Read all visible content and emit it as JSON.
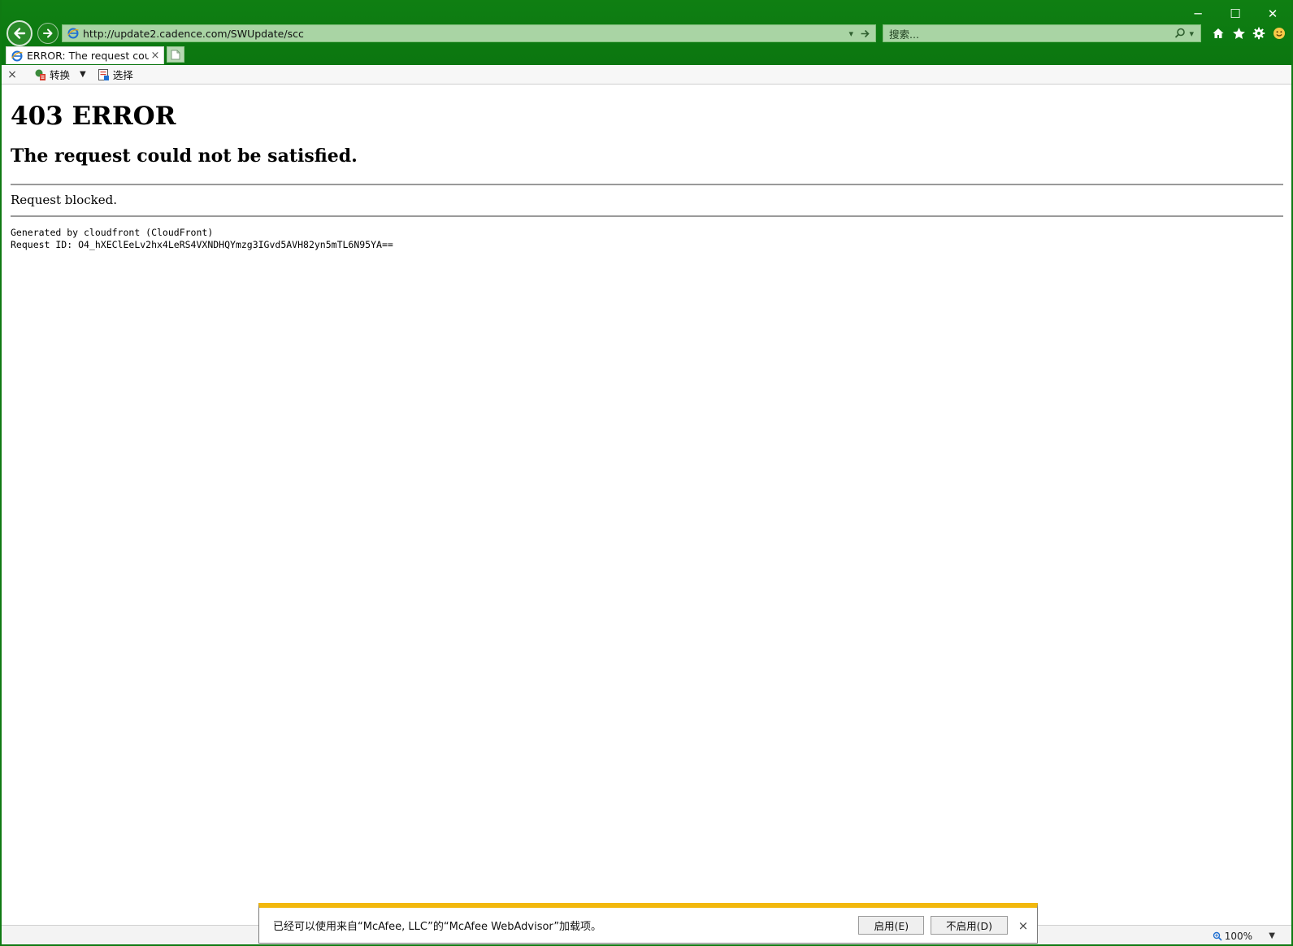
{
  "browser": {
    "address": {
      "url": "http://update2.cadence.com/SWUpdate/scc"
    },
    "search": {
      "placeholder": "搜索..."
    },
    "window_controls": {
      "minimize": "─",
      "maximize": "☐",
      "close": "✕"
    },
    "tab": {
      "title": "ERROR: The request coul...",
      "close": "×"
    },
    "toolbar": {
      "close": "×",
      "convert_label": "转换",
      "select_label": "选择"
    },
    "status": {
      "zoom": "100%"
    }
  },
  "page": {
    "heading": "403 ERROR",
    "subheading": "The request could not be satisfied.",
    "message": "Request blocked.",
    "generated_by": "Generated by cloudfront (CloudFront)",
    "request_id": "Request ID: O4_hXEClEeLv2hx4LeRS4VXNDHQYmzg3IGvd5AVH82yn5mTL6N95YA=="
  },
  "notification": {
    "message": "已经可以使用来自“McAfee, LLC”的“McAfee WebAdvisor”加载项。",
    "enable_label": "启用(E)",
    "disable_label": "不启用(D)",
    "close": "×"
  },
  "colors": {
    "chrome_green": "#0f7f12",
    "field_green": "#a9d4a4",
    "notify_accent": "#f2b80d"
  }
}
